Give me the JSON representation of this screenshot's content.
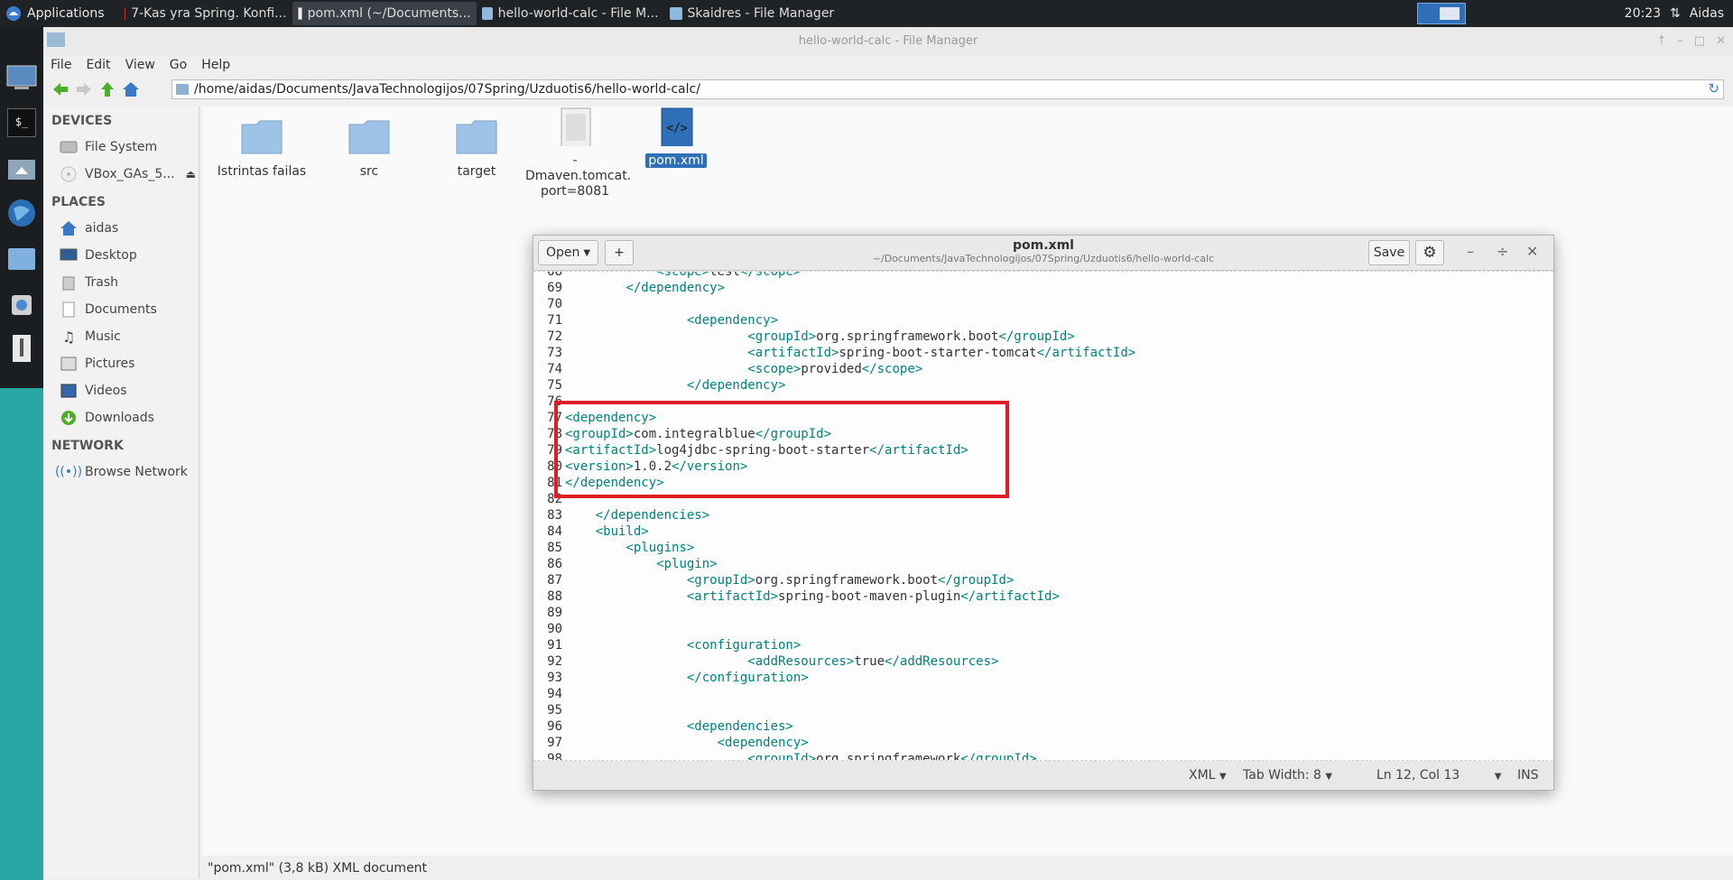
{
  "top_panel": {
    "applications_label": "Applications",
    "tasks": [
      {
        "label": "7-Kas yra Spring. Konfi...",
        "icon": "pdf-icon"
      },
      {
        "label": "pom.xml (~/Documents...",
        "icon": "text-editor-icon"
      },
      {
        "label": "hello-world-calc - File M...",
        "icon": "folder-icon"
      },
      {
        "label": "Skaidres - File Manager",
        "icon": "folder-icon"
      }
    ],
    "clock": "20:23",
    "user": "Aidas"
  },
  "file_manager": {
    "title": "hello-world-calc - File Manager",
    "menu": [
      "File",
      "Edit",
      "View",
      "Go",
      "Help"
    ],
    "path": "/home/aidas/Documents/JavaTechnologijos/07Spring/Uzduotis6/hello-world-calc/",
    "sidebar": {
      "devices_header": "DEVICES",
      "devices": [
        {
          "label": "File System",
          "icon": "harddisk-icon"
        },
        {
          "label": "VBox_GAs_5...",
          "icon": "optical-disc-icon"
        }
      ],
      "places_header": "PLACES",
      "places": [
        {
          "label": "aidas",
          "icon": "home-icon"
        },
        {
          "label": "Desktop",
          "icon": "desktop-icon"
        },
        {
          "label": "Trash",
          "icon": "trash-icon"
        },
        {
          "label": "Documents",
          "icon": "documents-icon"
        },
        {
          "label": "Music",
          "icon": "music-icon"
        },
        {
          "label": "Pictures",
          "icon": "pictures-icon"
        },
        {
          "label": "Videos",
          "icon": "videos-icon"
        },
        {
          "label": "Downloads",
          "icon": "downloads-icon"
        }
      ],
      "network_header": "NETWORK",
      "network": [
        {
          "label": "Browse Network",
          "icon": "network-icon"
        }
      ]
    },
    "files": [
      {
        "name": "Istrintas failas",
        "type": "folder"
      },
      {
        "name": "src",
        "type": "folder"
      },
      {
        "name": "target",
        "type": "folder"
      },
      {
        "name_line1": "-",
        "name_line2": "Dmaven.tomcat.",
        "name_line3": "port=8081",
        "type": "file"
      },
      {
        "name": "pom.xml",
        "type": "xml",
        "selected": true
      }
    ],
    "status": "\"pom.xml\" (3,8 kB) XML document"
  },
  "editor": {
    "open_label": "Open",
    "new_tab_label": "+",
    "save_label": "Save",
    "title": "pom.xml",
    "subtitle": "~/Documents/JavaTechnologijos/07Spring/Uzduotis6/hello-world-calc",
    "lines": [
      {
        "n": "68",
        "indent": "            ",
        "parts": [
          [
            "tag",
            "<scope>"
          ],
          [
            "text",
            "test"
          ],
          [
            "tag",
            "</scope>"
          ]
        ]
      },
      {
        "n": "69",
        "indent": "        ",
        "parts": [
          [
            "tag",
            "</dependency>"
          ]
        ]
      },
      {
        "n": "70",
        "indent": "",
        "parts": []
      },
      {
        "n": "71",
        "indent": "                ",
        "parts": [
          [
            "tag",
            "<dependency>"
          ]
        ]
      },
      {
        "n": "72",
        "indent": "                        ",
        "parts": [
          [
            "tag",
            "<groupId>"
          ],
          [
            "text",
            "org.springframework.boot"
          ],
          [
            "tag",
            "</groupId>"
          ]
        ]
      },
      {
        "n": "73",
        "indent": "                        ",
        "parts": [
          [
            "tag",
            "<artifactId>"
          ],
          [
            "text",
            "spring-boot-starter-tomcat"
          ],
          [
            "tag",
            "</artifactId>"
          ]
        ]
      },
      {
        "n": "74",
        "indent": "                        ",
        "parts": [
          [
            "tag",
            "<scope>"
          ],
          [
            "text",
            "provided"
          ],
          [
            "tag",
            "</scope>"
          ]
        ]
      },
      {
        "n": "75",
        "indent": "                ",
        "parts": [
          [
            "tag",
            "</dependency>"
          ]
        ]
      },
      {
        "n": "76",
        "indent": "",
        "parts": []
      },
      {
        "n": "77",
        "indent": "",
        "parts": [
          [
            "tag",
            "<dependency>"
          ]
        ]
      },
      {
        "n": "78",
        "indent": "",
        "parts": [
          [
            "tag",
            "<groupId>"
          ],
          [
            "text",
            "com.integralblue"
          ],
          [
            "tag",
            "</groupId>"
          ]
        ]
      },
      {
        "n": "79",
        "indent": "",
        "parts": [
          [
            "tag",
            "<artifactId>"
          ],
          [
            "text",
            "log4jdbc-spring-boot-starter"
          ],
          [
            "tag",
            "</artifactId>"
          ]
        ]
      },
      {
        "n": "80",
        "indent": "",
        "parts": [
          [
            "tag",
            "<version>"
          ],
          [
            "text",
            "1.0.2"
          ],
          [
            "tag",
            "</version>"
          ]
        ]
      },
      {
        "n": "81",
        "indent": "",
        "parts": [
          [
            "tag",
            "</dependency>"
          ]
        ]
      },
      {
        "n": "82",
        "indent": "",
        "parts": []
      },
      {
        "n": "83",
        "indent": "    ",
        "parts": [
          [
            "tag",
            "</dependencies>"
          ]
        ]
      },
      {
        "n": "84",
        "indent": "    ",
        "parts": [
          [
            "tag",
            "<build>"
          ]
        ]
      },
      {
        "n": "85",
        "indent": "        ",
        "parts": [
          [
            "tag",
            "<plugins>"
          ]
        ]
      },
      {
        "n": "86",
        "indent": "            ",
        "parts": [
          [
            "tag",
            "<plugin>"
          ]
        ]
      },
      {
        "n": "87",
        "indent": "                ",
        "parts": [
          [
            "tag",
            "<groupId>"
          ],
          [
            "text",
            "org.springframework.boot"
          ],
          [
            "tag",
            "</groupId>"
          ]
        ]
      },
      {
        "n": "88",
        "indent": "                ",
        "parts": [
          [
            "tag",
            "<artifactId>"
          ],
          [
            "text",
            "spring-boot-maven-plugin"
          ],
          [
            "tag",
            "</artifactId>"
          ]
        ]
      },
      {
        "n": "89",
        "indent": "",
        "parts": []
      },
      {
        "n": "90",
        "indent": "",
        "parts": []
      },
      {
        "n": "91",
        "indent": "                ",
        "parts": [
          [
            "tag",
            "<configuration>"
          ]
        ]
      },
      {
        "n": "92",
        "indent": "                        ",
        "parts": [
          [
            "tag",
            "<addResources>"
          ],
          [
            "text",
            "true"
          ],
          [
            "tag",
            "</addResources>"
          ]
        ]
      },
      {
        "n": "93",
        "indent": "                ",
        "parts": [
          [
            "tag",
            "</configuration>"
          ]
        ]
      },
      {
        "n": "94",
        "indent": "",
        "parts": []
      },
      {
        "n": "95",
        "indent": "",
        "parts": []
      },
      {
        "n": "96",
        "indent": "                ",
        "parts": [
          [
            "tag",
            "<dependencies>"
          ]
        ]
      },
      {
        "n": "97",
        "indent": "                    ",
        "parts": [
          [
            "tag",
            "<dependency>"
          ]
        ]
      },
      {
        "n": "98",
        "indent": "                        ",
        "parts": [
          [
            "tag",
            "<groupId>"
          ],
          [
            "text",
            "org.springframework"
          ],
          [
            "tag",
            "</groupId>"
          ]
        ]
      }
    ],
    "status": {
      "language": "XML",
      "tab_width": "Tab Width: 8",
      "position": "Ln 12, Col 13",
      "mode": "INS"
    },
    "colors": {
      "tag": "#008080",
      "highlight": "#e01c24"
    }
  }
}
